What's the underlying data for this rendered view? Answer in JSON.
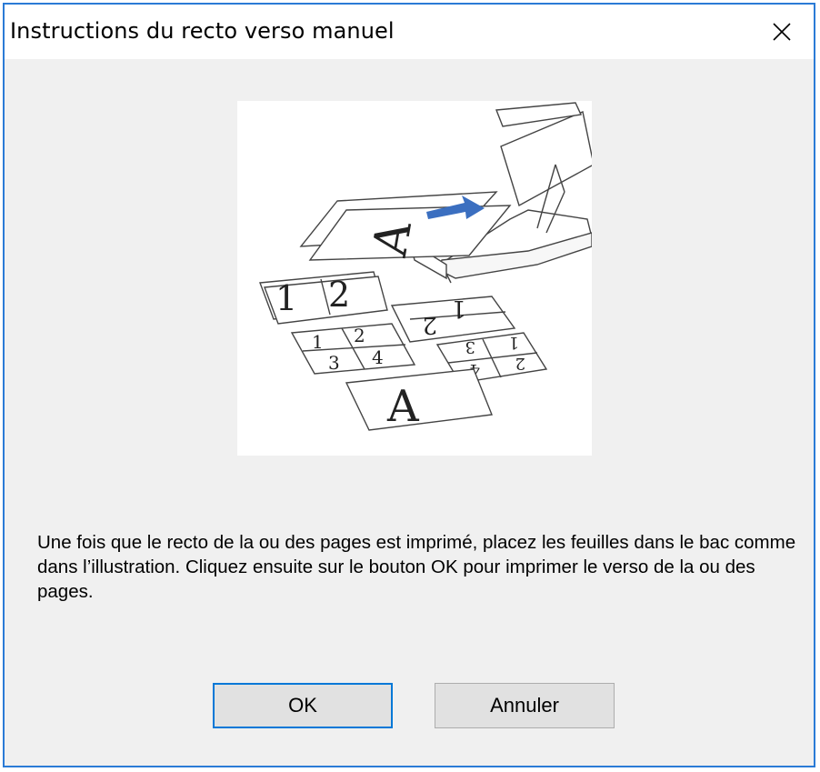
{
  "window": {
    "title": "Instructions du recto verso manuel",
    "close_icon": "close-icon"
  },
  "illustration": {
    "icon": "duplex-printer-tray-illustration",
    "pages": [
      "1",
      "2",
      "1",
      "2",
      "3",
      "4",
      "A"
    ],
    "accent": "#3b6fc0"
  },
  "message": {
    "text": "Une fois que le recto de la ou des pages est imprimé, placez les feuilles dans le bac comme dans l’illustration. Cliquez ensuite sur le bouton OK pour imprimer le verso de la ou des pages."
  },
  "buttons": {
    "ok_label": "OK",
    "cancel_label": "Annuler"
  },
  "colors": {
    "focus_border": "#0078d7",
    "window_border": "#2b7bd6",
    "dialog_bg": "#f0f0f0"
  }
}
